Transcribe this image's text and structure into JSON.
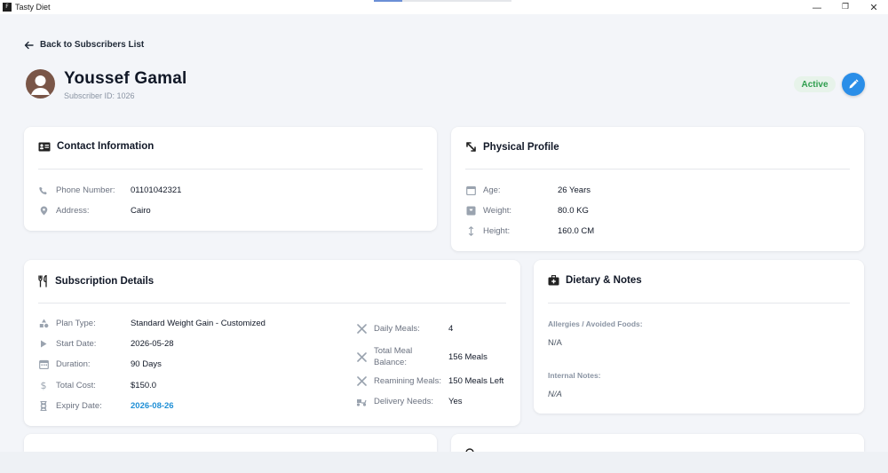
{
  "window": {
    "app_icon_text": "F",
    "title": "Tasty Diet",
    "controls": [
      "—",
      "❐",
      "✕"
    ]
  },
  "header": {
    "back_label": "Back to Subscribers List",
    "name": "Youssef Gamal",
    "subscriber_id": "Subscriber ID: 1026",
    "status": "Active"
  },
  "contact": {
    "title": "Contact Information",
    "phone_label": "Phone Number:",
    "phone_value": "01101042321",
    "address_label": "Address:",
    "address_value": "Cairo"
  },
  "physical": {
    "title": "Physical Profile",
    "age_label": "Age:",
    "age_value": "26 Years",
    "weight_label": "Weight:",
    "weight_value": "80.0 KG",
    "height_label": "Height:",
    "height_value": "160.0 CM"
  },
  "subscription": {
    "title": "Subscription Details",
    "plan_label": "Plan Type:",
    "plan_value": "Standard Weight Gain - Customized",
    "start_label": "Start Date:",
    "start_value": "2026-05-28",
    "duration_label": "Duration:",
    "duration_value": "90 Days",
    "cost_label": "Total Cost:",
    "cost_value": "$150.0",
    "expiry_label": "Expiry Date:",
    "expiry_value": "2026-08-26",
    "daily_label": "Daily Meals:",
    "daily_value": "4",
    "balance_label_1": "Total Meal",
    "balance_label_2": "Balance:",
    "balance_value": "156 Meals",
    "remaining_label": "Reamining Meals:",
    "remaining_value": "150 Meals Left",
    "delivery_label": "Delivery Needs:",
    "delivery_value": "Yes"
  },
  "dietary": {
    "title": "Dietary & Notes",
    "allergies_label": "Allergies / Avoided Foods:",
    "allergies_value": "N/A",
    "notes_label": "Internal Notes:",
    "notes_value": "N/A"
  },
  "colors": {
    "accent": "#2a8ee8",
    "active_text": "#2f9e4e",
    "active_bg": "#e7f3ea",
    "expiry": "#1f8fd6",
    "avatar": "#7a5648"
  }
}
